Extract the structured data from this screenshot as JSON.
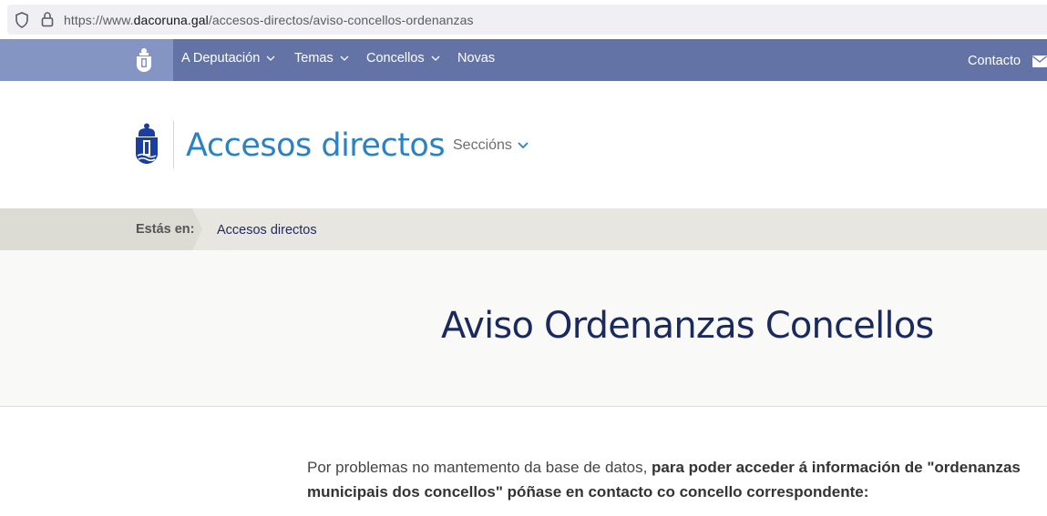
{
  "browser": {
    "url_prefix": "https://www.",
    "url_host": "dacoruna.gal",
    "url_path": "/accesos-directos/aviso-concellos-ordenanzas"
  },
  "nav": {
    "items": [
      {
        "label": "A Deputación"
      },
      {
        "label": "Temas"
      },
      {
        "label": "Concellos"
      },
      {
        "label": "Novas"
      }
    ],
    "contact_label": "Contacto"
  },
  "section": {
    "title": "Accesos directos",
    "sections_label": "Seccións"
  },
  "breadcrumb": {
    "label": "Estás en:",
    "current": "Accesos directos"
  },
  "page": {
    "title": "Aviso Ordenanzas Concellos",
    "body_intro": "Por problemas no mantemento da base de datos,",
    "body_bold": "para poder acceder á información de \"ordenanzas municipais dos concellos\" póñase en contacto co concello correspondente:"
  },
  "colors": {
    "nav_bg": "#6373a6",
    "nav_left_bg": "#8495c4",
    "section_title": "#2a82c4",
    "page_title": "#1a2a5e",
    "breadcrumb_bg": "#e7e6e0"
  }
}
